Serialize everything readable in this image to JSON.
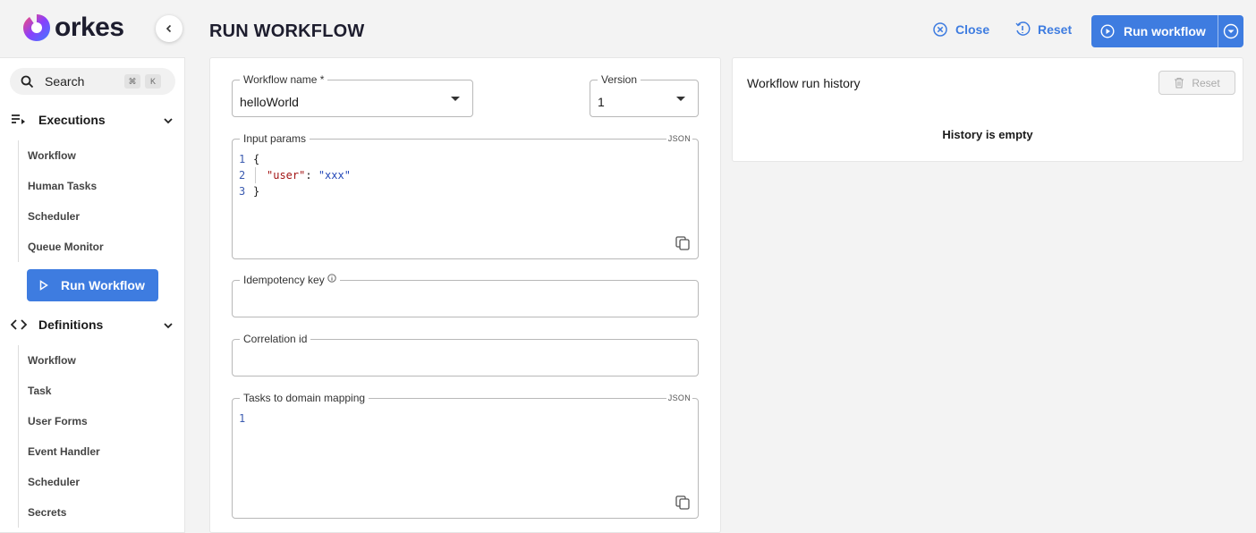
{
  "brand": {
    "name": "orkes"
  },
  "sidebar": {
    "search_label": "Search",
    "shortcut_keys": [
      "⌘",
      "K"
    ],
    "executions": {
      "title": "Executions",
      "items": [
        "Workflow",
        "Human Tasks",
        "Scheduler",
        "Queue Monitor"
      ]
    },
    "run_workflow_label": "Run Workflow",
    "definitions": {
      "title": "Definitions",
      "items": [
        "Workflow",
        "Task",
        "User Forms",
        "Event Handler",
        "Scheduler",
        "Secrets"
      ]
    }
  },
  "header": {
    "title": "RUN WORKFLOW",
    "close_label": "Close",
    "reset_label": "Reset",
    "run_label": "Run workflow"
  },
  "form": {
    "workflow_name": {
      "label": "Workflow name *",
      "value": "helloWorld"
    },
    "version": {
      "label": "Version",
      "value": "1"
    },
    "input_params": {
      "label": "Input params",
      "tag": "JSON",
      "lines": [
        {
          "num": "1",
          "text": "{"
        },
        {
          "num": "2",
          "key": "\"user\"",
          "sep": ": ",
          "val": "\"xxx\""
        },
        {
          "num": "3",
          "text": "}"
        }
      ]
    },
    "idempotency_key": {
      "label": "Idempotency key",
      "value": ""
    },
    "correlation_id": {
      "label": "Correlation id",
      "value": ""
    },
    "tasks_mapping": {
      "label": "Tasks to domain mapping",
      "tag": "JSON",
      "lines": [
        {
          "num": "1",
          "text": ""
        }
      ]
    }
  },
  "history": {
    "title": "Workflow run history",
    "reset_label": "Reset",
    "empty_text": "History is empty"
  },
  "colors": {
    "accent": "#3e7ce0",
    "background": "#f3f3f3"
  }
}
